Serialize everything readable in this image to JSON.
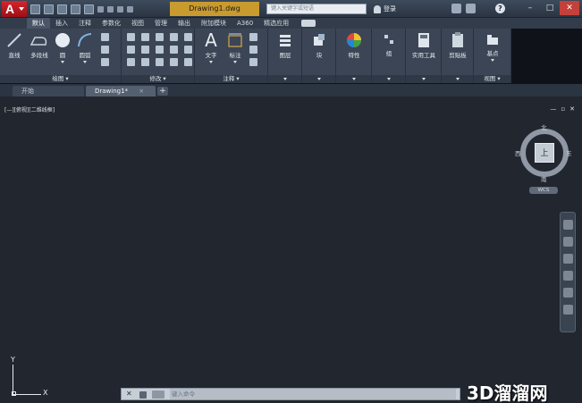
{
  "app": {
    "logo_letter": "A",
    "title": "Drawing1.dwg"
  },
  "search": {
    "placeholder": "键入关键字或短语"
  },
  "login": {
    "label": "登录"
  },
  "help": {
    "label": "?"
  },
  "window": {
    "minimize": "–",
    "maximize": "□",
    "close": "✕"
  },
  "ribbon_tabs": [
    "默认",
    "插入",
    "注释",
    "参数化",
    "视图",
    "管理",
    "输出",
    "附加模块",
    "A360",
    "精选应用"
  ],
  "ribbon": {
    "draw": {
      "label": "绘图 ▾",
      "line": "直线",
      "polyline": "多段线",
      "circle": "圆",
      "arc": "圆弧"
    },
    "modify": {
      "label": "修改 ▾"
    },
    "annotation": {
      "label": "注释 ▾",
      "text": "文字",
      "dimension": "标注"
    },
    "layers": {
      "label": "图层"
    },
    "block": {
      "label": "块"
    },
    "properties": {
      "label": "特性"
    },
    "groups": {
      "label": "组"
    },
    "utilities": {
      "label": "实用工具"
    },
    "clipboard": {
      "label": "剪贴板"
    },
    "view": {
      "label": "视图 ▾",
      "base": "基点"
    }
  },
  "file_tabs": {
    "start": "开始",
    "drawing": "Drawing1*",
    "close": "×",
    "add": "+"
  },
  "viewport": {
    "label": "[—][俯视][二维线框]",
    "minimize": "—",
    "restore": "▫",
    "close": "✕"
  },
  "viewcube": {
    "top": "上",
    "north": "北",
    "south": "南",
    "east": "东",
    "west": "西",
    "wcs": "WCS"
  },
  "ucs": {
    "x": "X",
    "y": "Y"
  },
  "command": {
    "close": "✕",
    "placeholder": "键入命令"
  },
  "watermark": "3D溜溜网"
}
